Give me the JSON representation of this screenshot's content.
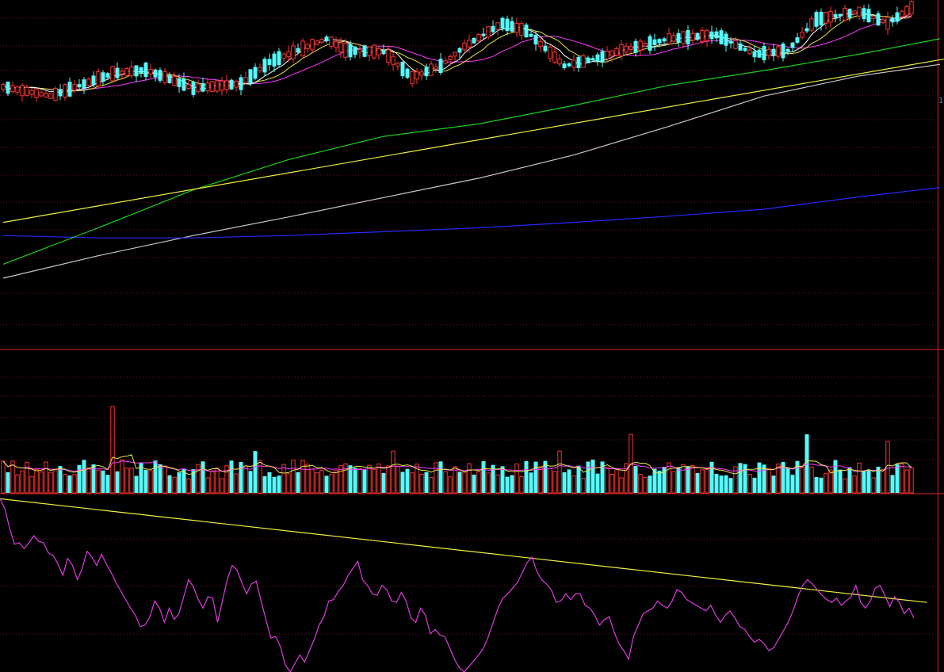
{
  "colors": {
    "background": "#000000",
    "grid": "#7a1414",
    "frame": "#b01e1e",
    "candle_up": "#ff3232",
    "candle_down": "#54fcfc",
    "ma5": "#ffffff",
    "ma10": "#e8e84a",
    "ma20": "#ff3cff",
    "ma60": "#1cd21c",
    "ma120": "#c8c8c8",
    "ma250": "#2828ff",
    "trend_line": "#f0f040",
    "osc_line": "#e03ce0",
    "axis_text": "#4f7fd6"
  },
  "chart_data": [
    {
      "type": "candlestick",
      "panel": "price",
      "axis_labels": [
        "1"
      ],
      "trend_line": [
        {
          "x": 0,
          "y": 16.3
        },
        {
          "x": 199,
          "y": 37.5
        }
      ],
      "lines": [
        {
          "id": "ma120",
          "color": "#c8c8c8",
          "points": [
            [
              0,
              9.1
            ],
            [
              20,
              12.0
            ],
            [
              40,
              14.6
            ],
            [
              60,
              17.0
            ],
            [
              80,
              19.5
            ],
            [
              100,
              22.0
            ],
            [
              120,
              25.0
            ],
            [
              140,
              28.7
            ],
            [
              160,
              32.6
            ],
            [
              180,
              35.2
            ],
            [
              197,
              36.7
            ]
          ]
        },
        {
          "id": "ma250",
          "color": "#2828ff",
          "points": [
            [
              0,
              14.6
            ],
            [
              20,
              14.3
            ],
            [
              40,
              14.3
            ],
            [
              60,
              14.6
            ],
            [
              80,
              15.1
            ],
            [
              100,
              15.6
            ],
            [
              120,
              16.3
            ],
            [
              140,
              17.1
            ],
            [
              160,
              18.0
            ],
            [
              180,
              19.6
            ],
            [
              197,
              20.8
            ]
          ]
        },
        {
          "id": "ma60",
          "color": "#1cd21c",
          "points": [
            [
              0,
              10.9
            ],
            [
              20,
              15.6
            ],
            [
              40,
              20.5
            ],
            [
              60,
              24.4
            ],
            [
              80,
              27.4
            ],
            [
              100,
              29.0
            ],
            [
              120,
              31.4
            ],
            [
              140,
              34.0
            ],
            [
              160,
              35.9
            ],
            [
              180,
              38.0
            ],
            [
              197,
              40.0
            ]
          ]
        }
      ],
      "ylim": [
        0,
        45
      ]
    },
    {
      "type": "bar",
      "panel": "volume",
      "series": [
        {
          "values": []
        },
        {
          "values": []
        }
      ],
      "ylim": [
        0,
        100
      ]
    },
    {
      "type": "line",
      "panel": "oscillator",
      "trend_line": [
        {
          "x": 0,
          "y": 97
        },
        {
          "x": 203,
          "y": 24
        }
      ],
      "series": [
        {
          "values": [
            97,
            90,
            76,
            65,
            66,
            62,
            66,
            71,
            67,
            66,
            59,
            57,
            51,
            43,
            55,
            50,
            40,
            48,
            60,
            56,
            50,
            58,
            51,
            45,
            38,
            32,
            26,
            20,
            15,
            7,
            8,
            14,
            25,
            20,
            10,
            20,
            12,
            16,
            28,
            40,
            35,
            26,
            20,
            28,
            27,
            10,
            25,
            40,
            50,
            47,
            38,
            30,
            37,
            39,
            25,
            12,
            -1,
            0,
            -7,
            -20,
            -25,
            -19,
            -13,
            -18,
            -10,
            -2,
            8,
            14,
            25,
            26,
            32,
            36,
            43,
            48,
            53,
            40,
            36,
            30,
            29,
            36,
            33,
            25,
            24,
            31,
            25,
            13,
            10,
            20,
            15,
            2,
            5,
            1,
            0,
            -8,
            -16,
            -22,
            -25,
            -21,
            -17,
            -13,
            -8,
            0,
            10,
            20,
            27,
            30,
            34,
            38,
            45,
            52,
            56,
            46,
            40,
            37,
            33,
            24,
            25,
            30,
            26,
            30,
            30,
            22,
            20,
            15,
            8,
            12,
            14,
            3,
            -5,
            -10,
            -16,
            0,
            8,
            16,
            18,
            20,
            25,
            22,
            20,
            25,
            33,
            31,
            26,
            24,
            22,
            20,
            18,
            22,
            15,
            10,
            15,
            18,
            13,
            7,
            5,
            0,
            -4,
            -2,
            -5,
            -10,
            -8,
            -2,
            4,
            10,
            18,
            28,
            36,
            40,
            37,
            33,
            29,
            26,
            24,
            27,
            22,
            25,
            28,
            36,
            24,
            20,
            25,
            34,
            36,
            29,
            21,
            28,
            24,
            16,
            20,
            13
          ]
        }
      ],
      "ylim": [
        -25,
        100
      ]
    }
  ]
}
